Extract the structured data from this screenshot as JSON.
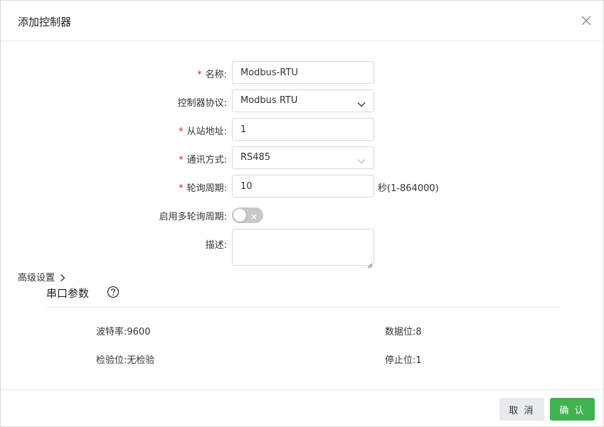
{
  "dialog": {
    "title": "添加控制器"
  },
  "form": {
    "name": {
      "label": "名称:",
      "required": true,
      "value": "Modbus-RTU"
    },
    "protocol": {
      "label": "控制器协议:",
      "required": false,
      "value": "Modbus RTU"
    },
    "slave_address": {
      "label": "从站地址:",
      "required": true,
      "value": "1"
    },
    "comm_mode": {
      "label": "通讯方式:",
      "required": true,
      "value": "RS485"
    },
    "poll_period": {
      "label": "轮询周期:",
      "required": true,
      "value": "10",
      "unit": "秒(1-864000)"
    },
    "multi_poll": {
      "label": "启用多轮询周期:",
      "enabled": false
    },
    "description": {
      "label": "描述:",
      "value": ""
    },
    "required_mark": "*"
  },
  "advanced": {
    "label": "高级设置"
  },
  "serial": {
    "title": "串口参数",
    "baud_rate": "波特率:9600",
    "data_bits": "数据位:8",
    "parity": "检验位:无检验",
    "stop_bits": "停止位:1"
  },
  "footer": {
    "cancel_label": "取 消",
    "ok_label": "确 认"
  },
  "colors": {
    "accent": "#3fb34f",
    "required": "#e02424",
    "switch_off": "#c8c8c8"
  }
}
